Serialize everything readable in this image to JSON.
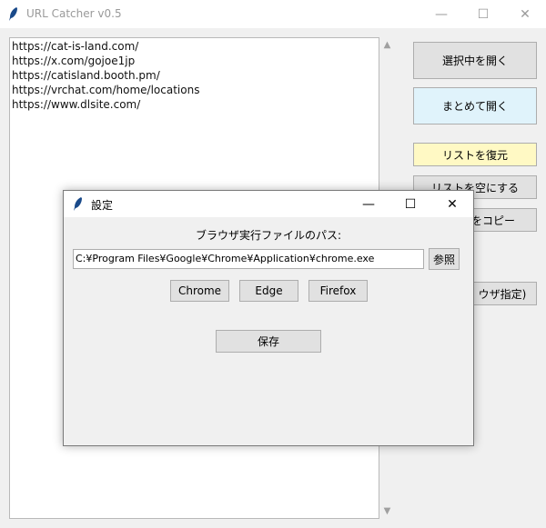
{
  "window": {
    "title": "URL Catcher v0.5",
    "controls": {
      "minimize": "—",
      "maximize": "☐",
      "close": "✕"
    }
  },
  "url_list": [
    "https://cat-is-land.com/",
    "https://x.com/gojoe1jp",
    "https://catisland.booth.pm/",
    "https://vrchat.com/home/locations",
    "https://www.dlsite.com/"
  ],
  "scrollbar": {
    "up": "▲",
    "down": "▼"
  },
  "side_buttons": {
    "open_selected": "選択中を開く",
    "open_all": "まとめて開く",
    "restore_list": "リストを復元",
    "clear_list": "リストを空にする",
    "copy_partial": "をコピー",
    "browser_partial": "ウザ指定)"
  },
  "colors": {
    "open_all_bg": "#e0f3fb",
    "restore_bg": "#fff9c4",
    "button_bg": "#e1e1e1"
  },
  "settings_dialog": {
    "title": "設定",
    "label": "ブラウザ実行ファイルのパス:",
    "path_value": "C:¥Program Files¥Google¥Chrome¥Application¥chrome.exe",
    "browse_button": "参照",
    "chrome_button": "Chrome",
    "edge_button": "Edge",
    "firefox_button": "Firefox",
    "save_button": "保存",
    "controls": {
      "minimize": "—",
      "maximize": "☐",
      "close": "✕"
    }
  }
}
